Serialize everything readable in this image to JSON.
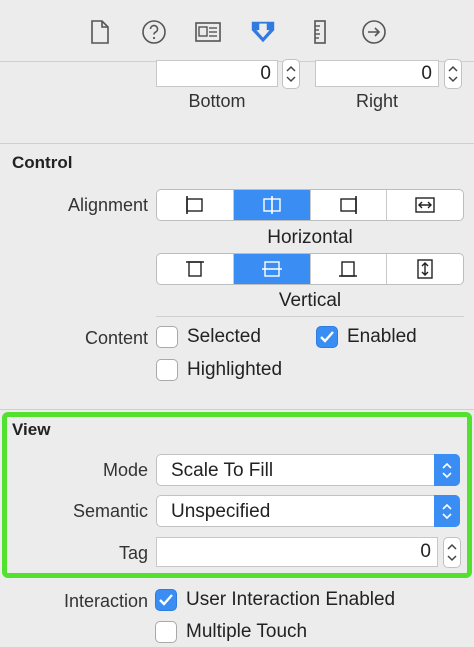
{
  "toolbar": {
    "tabs": [
      {
        "name": "file-inspector",
        "icon": "file-icon"
      },
      {
        "name": "quick-help",
        "icon": "help-icon"
      },
      {
        "name": "identity-inspector",
        "icon": "identity-card-icon"
      },
      {
        "name": "attributes-inspector",
        "icon": "attributes-arrow-icon",
        "selected": true
      },
      {
        "name": "size-inspector",
        "icon": "ruler-icon"
      },
      {
        "name": "connections-inspector",
        "icon": "arrow-circle-icon"
      }
    ],
    "accent": "#2f7be0"
  },
  "insets": {
    "bottom": {
      "value": "0",
      "label": "Bottom"
    },
    "right": {
      "value": "0",
      "label": "Right"
    }
  },
  "control": {
    "title": "Control",
    "alignment_label": "Alignment",
    "horizontal_caption": "Horizontal",
    "vertical_caption": "Vertical",
    "horizontal_selected": 1,
    "vertical_selected": 1,
    "content_label": "Content",
    "selected_label": "Selected",
    "selected_checked": false,
    "enabled_label": "Enabled",
    "enabled_checked": true,
    "highlighted_label": "Highlighted",
    "highlighted_checked": false
  },
  "view": {
    "title": "View",
    "mode_label": "Mode",
    "mode_value": "Scale To Fill",
    "semantic_label": "Semantic",
    "semantic_value": "Unspecified",
    "tag_label": "Tag",
    "tag_value": "0",
    "highlight_color": "#53e12f"
  },
  "interaction": {
    "label": "Interaction",
    "user_interaction_label": "User Interaction Enabled",
    "user_interaction_checked": true,
    "multiple_touch_label": "Multiple Touch",
    "multiple_touch_checked": false
  }
}
